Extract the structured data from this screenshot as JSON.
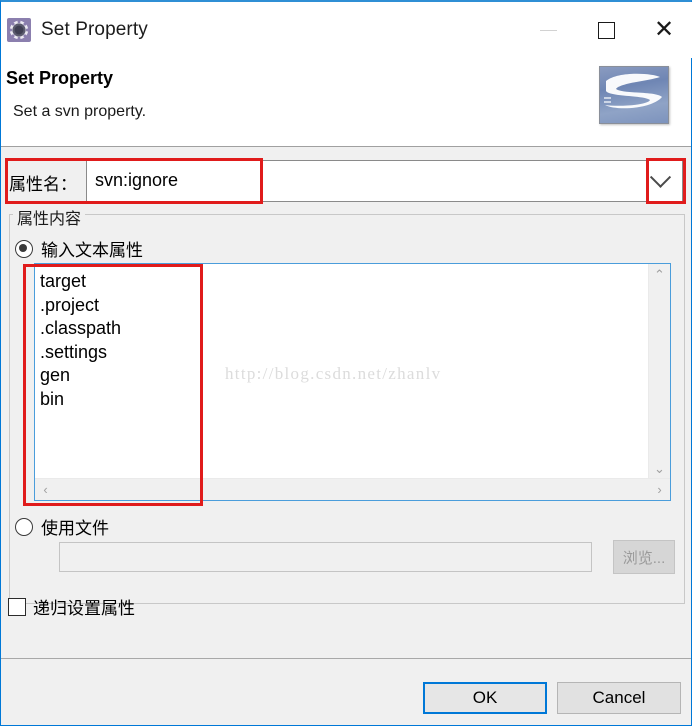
{
  "window": {
    "title": "Set Property",
    "app_icon": "gear-icon",
    "controls": {
      "minimize": "–",
      "maximize": "□",
      "close": "✕"
    }
  },
  "header": {
    "title": "Set Property",
    "subtitle": "Set a svn property.",
    "logo": "subversion-logo"
  },
  "property_name": {
    "label": "属性名：",
    "value": "svn:ignore",
    "dropdown_icon": "chevron-down-icon"
  },
  "content_group": {
    "legend": "属性内容",
    "text_radio": {
      "label": "输入文本属性",
      "checked": true
    },
    "textarea": {
      "lines": [
        "target",
        ".project",
        ".classpath",
        ".settings",
        "gen",
        "bin"
      ],
      "watermark": "http://blog.csdn.net/zhanlv",
      "scroll_up_icon": "chevron-up-icon",
      "scroll_down_icon": "chevron-down-icon",
      "scroll_left_icon": "chevron-left-icon",
      "scroll_right_icon": "chevron-right-icon"
    },
    "file_radio": {
      "label": "使用文件",
      "checked": false
    },
    "file_path": {
      "value": "",
      "placeholder": ""
    },
    "browse_button": {
      "label": "浏览...",
      "disabled": true
    }
  },
  "recursive_checkbox": {
    "label": "递归设置属性",
    "checked": false
  },
  "footer": {
    "ok_label": "OK",
    "cancel_label": "Cancel"
  },
  "colors": {
    "accent": "#0078d7",
    "annotation": "#e01b1b",
    "field_focus": "#4a9ddb",
    "dialog_bg": "#f0f0f0"
  }
}
